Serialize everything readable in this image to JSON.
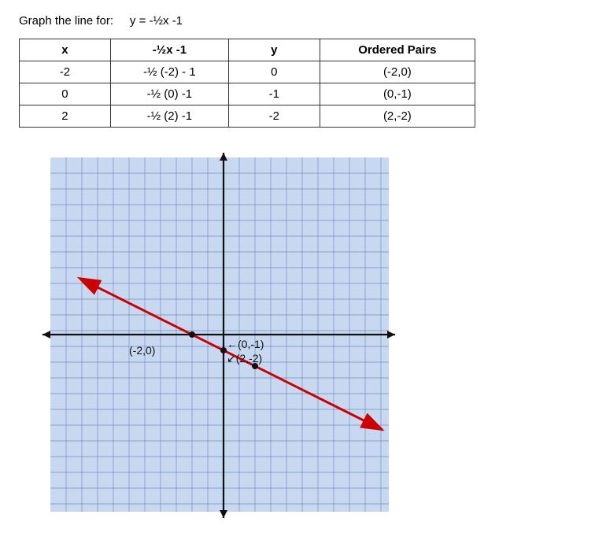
{
  "instruction": {
    "prefix": "Graph the line for:",
    "equation": "y = -½x -1"
  },
  "table": {
    "headers": [
      "x",
      "-½x -1",
      "y",
      "Ordered Pairs"
    ],
    "rows": [
      {
        "x": "-2",
        "expr": "-½ (-2) - 1",
        "y": "0",
        "pair": "(-2,0)"
      },
      {
        "x": "0",
        "expr": "-½ (0) -1",
        "y": "-1",
        "pair": "(0,-1)"
      },
      {
        "x": "2",
        "expr": "-½ (2) -1",
        "y": "-2",
        "pair": "(2,-2)"
      }
    ]
  },
  "graph": {
    "labels": {
      "p1": "(-2,0)",
      "p2": "(0,-1)",
      "p3": "(2,-2)"
    }
  }
}
